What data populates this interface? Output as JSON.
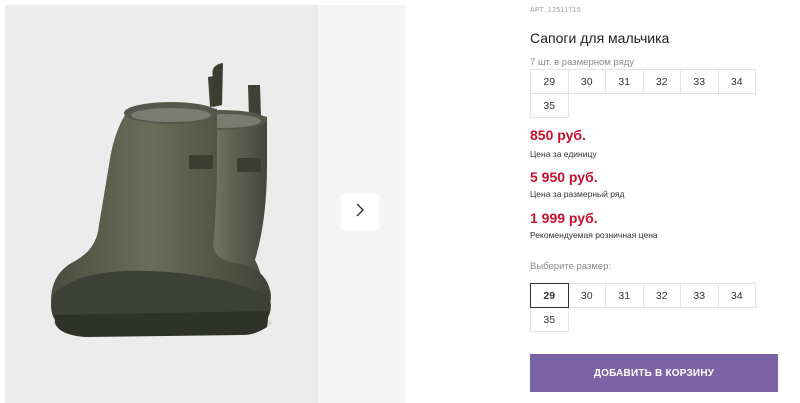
{
  "product": {
    "article": "АРТ. 12511715",
    "title": "Сапоги для мальчика",
    "image_icon": "rubber-boots-photo"
  },
  "size_set": {
    "label": "7 шт. в размерном ряду",
    "sizes": [
      "29",
      "30",
      "31",
      "32",
      "33",
      "34",
      "35"
    ]
  },
  "prices": [
    {
      "value": "850 руб.",
      "note": "Цена за единицу"
    },
    {
      "value": "5 950 руб.",
      "note": "Цена за размерный ряд"
    },
    {
      "value": "1 999 руб.",
      "note": "Рекомендуемая розничная цена"
    }
  ],
  "size_select": {
    "label": "Выберите размер:",
    "sizes": [
      "29",
      "30",
      "31",
      "32",
      "33",
      "34",
      "35"
    ],
    "selected": "29"
  },
  "cart": {
    "label": "ДОБАВИТЬ В КОРЗИНУ"
  },
  "colors": {
    "accent": "#7b63a6",
    "price": "#c8102e",
    "gallery_bg": "#ececec"
  }
}
